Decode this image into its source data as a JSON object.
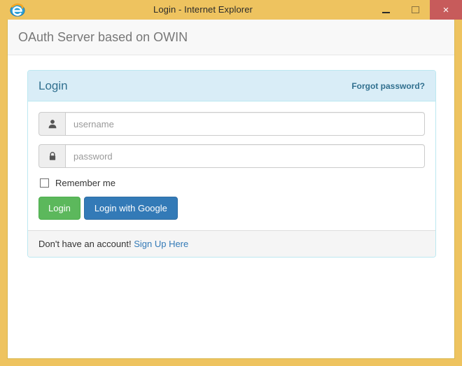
{
  "window": {
    "title": "Login - Internet Explorer",
    "app_icon": "internet-explorer-icon",
    "frame_color": "#eec35f",
    "controls": {
      "minimize": "minimize-icon",
      "maximize": "maximize-icon",
      "close": "×",
      "close_color": "#c75b5b"
    }
  },
  "site": {
    "brand": "OAuth Server based on OWIN"
  },
  "panel": {
    "title": "Login",
    "forgot_password": "Forgot password?",
    "accent_bg": "#d9edf7",
    "accent_border": "#bce8f1",
    "accent_text": "#31708f",
    "fields": [
      {
        "name": "username",
        "icon": "user-icon",
        "value": "",
        "placeholder": "username"
      },
      {
        "name": "password",
        "icon": "lock-icon",
        "value": "",
        "placeholder": "password"
      }
    ],
    "remember_me": {
      "label": "Remember me",
      "checked": false
    },
    "buttons": {
      "login": "Login",
      "login_google": "Login with Google",
      "login_color": "#5cb85c",
      "login_google_color": "#337ab7"
    },
    "footer": {
      "text": "Don't have an account!",
      "link": "Sign Up Here",
      "link_color": "#337ab7"
    }
  }
}
